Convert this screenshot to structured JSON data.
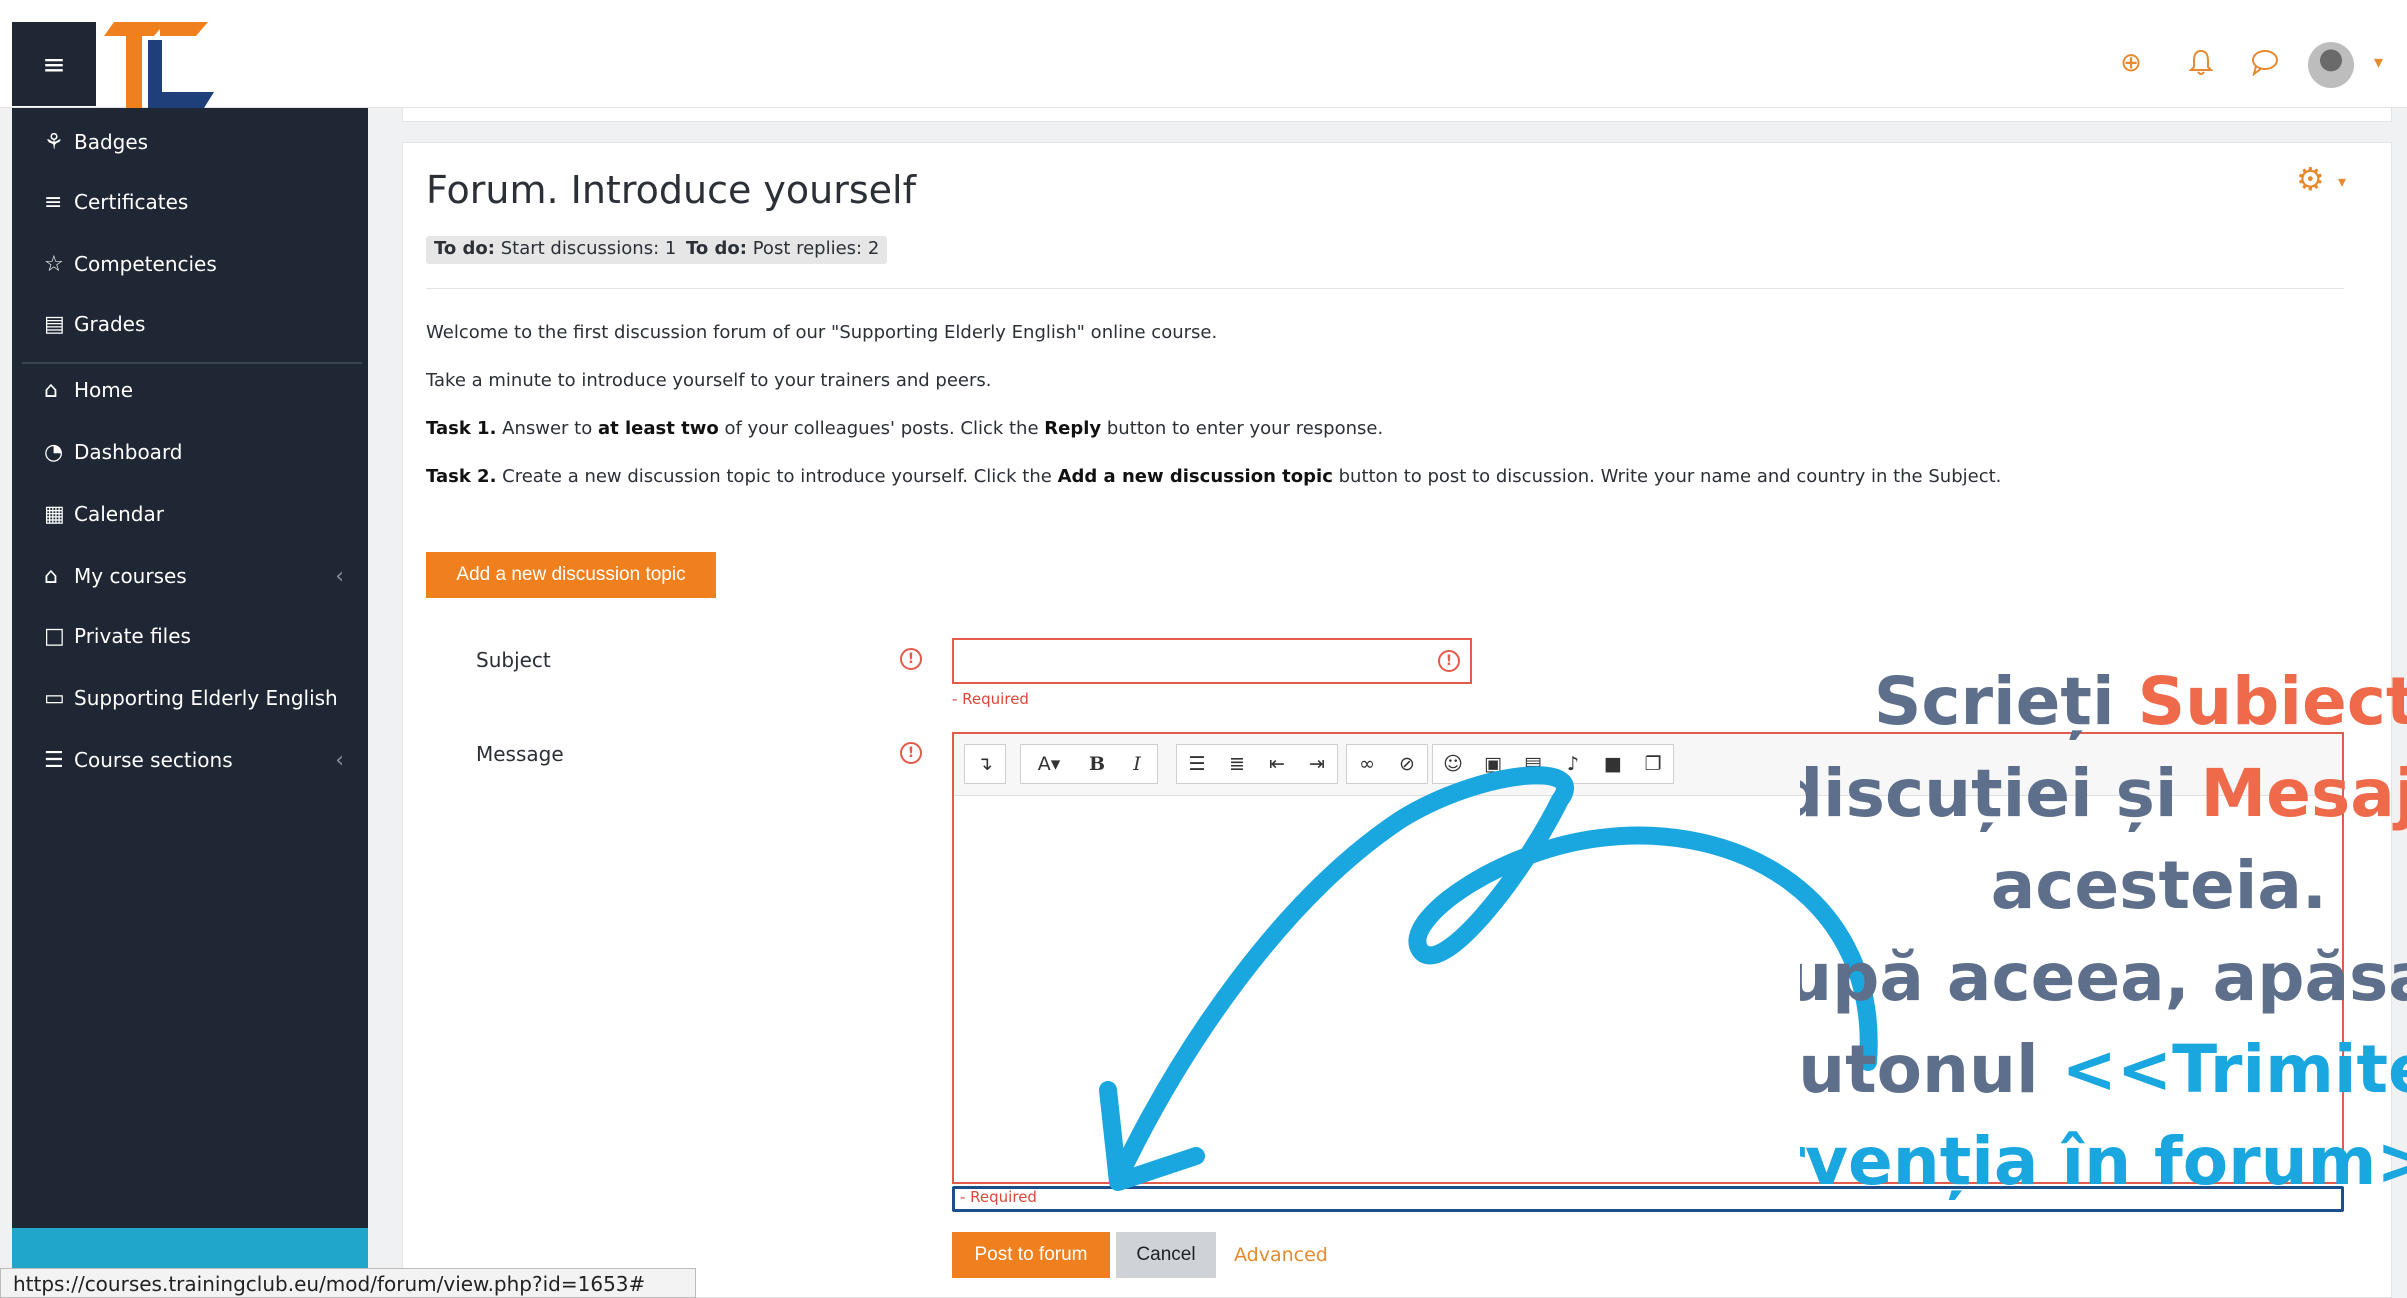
{
  "navbar": {
    "menu_icon": "hamburger-icon",
    "logo": "TC logo",
    "icons": [
      "globe-icon",
      "bell-icon",
      "chat-icon"
    ],
    "colors": {
      "accent": "#f07f1e",
      "brand_dark": "#1e2733"
    }
  },
  "sidebar": {
    "items": [
      {
        "label": "Badges",
        "icon": "badge-icon"
      },
      {
        "label": "Certificates",
        "icon": "certificate-icon"
      },
      {
        "label": "Competencies",
        "icon": "star-icon"
      },
      {
        "label": "Grades",
        "icon": "grades-icon"
      },
      {
        "label": "Home",
        "icon": "home-icon"
      },
      {
        "label": "Dashboard",
        "icon": "dashboard-icon"
      },
      {
        "label": "Calendar",
        "icon": "calendar-icon"
      },
      {
        "label": "My courses",
        "icon": "graduation-cap-icon"
      },
      {
        "label": "Private files",
        "icon": "file-icon"
      },
      {
        "label": "Supporting Elderly English",
        "icon": "folder-icon"
      },
      {
        "label": "Course sections",
        "icon": "list-icon"
      }
    ]
  },
  "status_bar": {
    "url": "https://courses.trainingclub.eu/mod/forum/view.php?id=1653#"
  },
  "main": {
    "title": "Forum. Introduce yourself",
    "todo": [
      {
        "prefix": "To do:",
        "text": "Start discussions: 1"
      },
      {
        "prefix": "To do:",
        "text": "Post replies: 2"
      }
    ],
    "intro": {
      "line1": "Welcome to the first discussion forum of our \"Supporting Elderly English\" online course.",
      "line2": "Take a minute to introduce yourself to your trainers and peers.",
      "task1_label": "Task 1.",
      "task1_a": "Answer to",
      "task1_b": "at least two",
      "task1_c": "of your colleagues' posts. Click the",
      "task1_d": "Reply",
      "task1_e": "button to enter your response.",
      "task2_label": "Task 2.",
      "task2_a": "Create a new discussion topic to introduce yourself. Click the",
      "task2_b": "Add a new discussion topic",
      "task2_c": "button to post to discussion. Write your name and country in the Subject."
    },
    "add_topic_button": "Add a new discussion topic",
    "form": {
      "subject_label": "Subject",
      "subject_value": "",
      "subject_required": "- Required",
      "message_label": "Message",
      "message_required": "- Required"
    },
    "buttons": {
      "post": "Post to forum",
      "cancel": "Cancel",
      "advanced": "Advanced"
    }
  },
  "overlay": {
    "l1a": "Scrieți ",
    "l1b": "Subiectul",
    "l2a": "discuției și ",
    "l2b": "Mesajul",
    "l3": "acesteia.",
    "l4": "După aceea, apăsați",
    "l5a": "butonul ",
    "l5b": "<<Trimiteți",
    "l6": "intervenția în forum>>"
  }
}
